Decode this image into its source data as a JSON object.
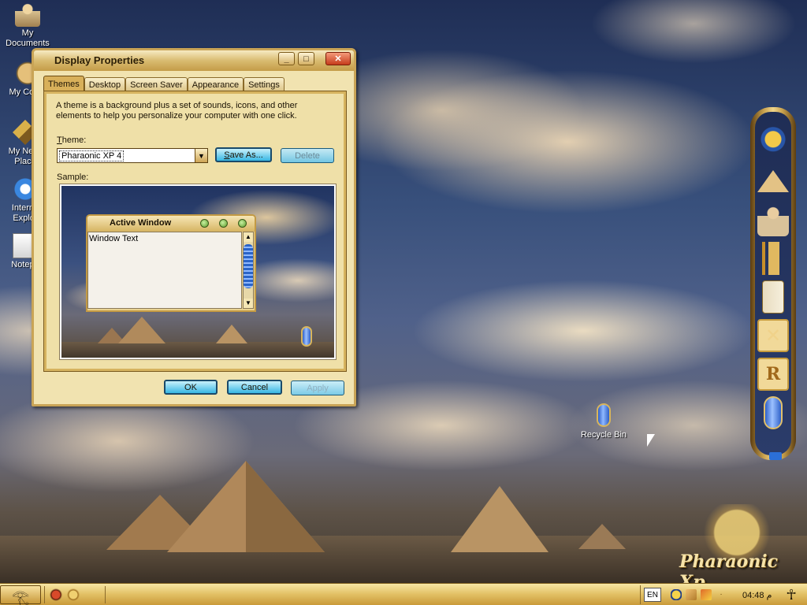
{
  "desktop": {
    "icons": [
      {
        "label": "My\nDocuments",
        "icon": "pharaoh-figure-icon"
      },
      {
        "label": "My Comp",
        "icon": "my-computer-icon"
      },
      {
        "label": "My Netw\nPlace",
        "icon": "network-places-icon"
      },
      {
        "label": "Interne\nExplor",
        "icon": "internet-explorer-icon"
      },
      {
        "label": "Notepa",
        "icon": "notepad-icon"
      }
    ],
    "recycle_bin": {
      "label": "Recycle Bin",
      "icon": "cartouche-recycle-bin-icon"
    },
    "logo_text": "Pharaonic Xp"
  },
  "dock": {
    "items": [
      {
        "icon": "tutankhamun-mask-icon"
      },
      {
        "icon": "pyramids-icon"
      },
      {
        "icon": "scribe-icon"
      },
      {
        "icon": "harp-icon"
      },
      {
        "icon": "book-icon"
      },
      {
        "icon": "tools-icon"
      },
      {
        "icon": "run-icon",
        "glyph": "R"
      },
      {
        "icon": "recycle-bin-icon"
      }
    ]
  },
  "window": {
    "title": "Display Properties",
    "controls": {
      "minimize": "_",
      "maximize": "□",
      "close": "✕"
    },
    "tabs": [
      {
        "label": "Themes",
        "active": true
      },
      {
        "label": "Desktop",
        "active": false
      },
      {
        "label": "Screen Saver",
        "active": false
      },
      {
        "label": "Appearance",
        "active": false
      },
      {
        "label": "Settings",
        "active": false
      }
    ],
    "description": "A theme is a background plus a set of sounds, icons, and other elements to help you personalize your computer with one click.",
    "theme_label_prefix": "T",
    "theme_label_rest": "heme:",
    "theme_value": "Pharaonic XP 4",
    "save_as_prefix": "S",
    "save_as_rest": "ave As...",
    "delete_label": "Delete",
    "sample_label": "Sample:",
    "sample": {
      "active_window_title": "Active Window",
      "window_text": "Window Text"
    },
    "ok_label": "OK",
    "cancel_label": "Cancel",
    "apply_label": "Apply"
  },
  "taskbar": {
    "start_glyph": "𓂀",
    "language": "EN",
    "clock": "04:48 م",
    "ankh": "☥"
  }
}
